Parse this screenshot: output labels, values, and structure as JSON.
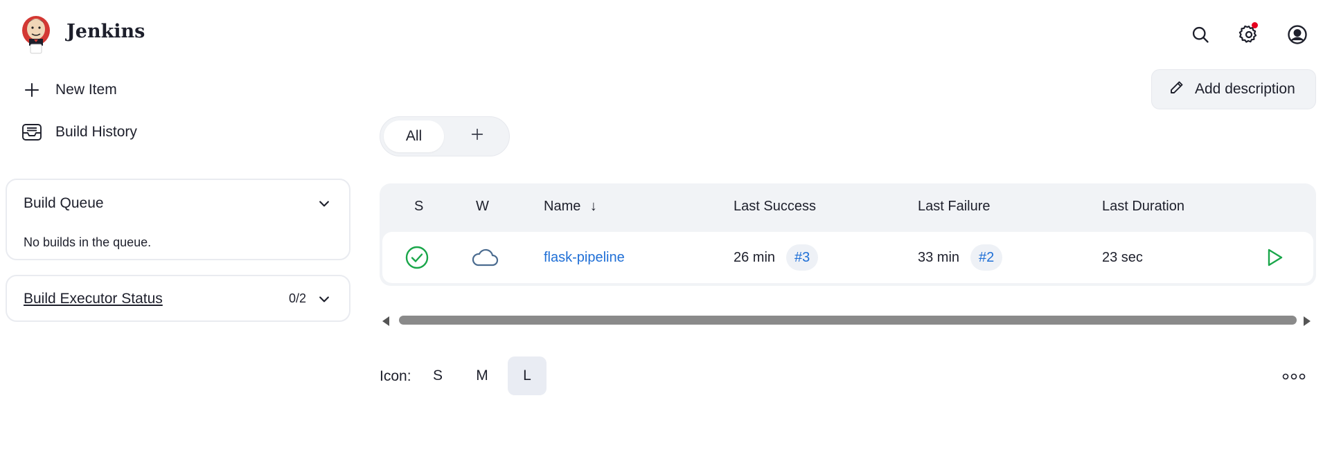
{
  "header": {
    "brand": "Jenkins",
    "icons": [
      "search-icon",
      "settings-icon",
      "user-icon"
    ],
    "notification_color": "#e6001f"
  },
  "sidebar": {
    "new_item": "New Item",
    "build_history": "Build History",
    "build_queue": {
      "title": "Build Queue",
      "empty_text": "No builds in the queue."
    },
    "executor_status": {
      "title": "Build Executor Status",
      "count": "0/2"
    }
  },
  "main": {
    "add_description": "Add description",
    "tabs": {
      "all": "All"
    },
    "table": {
      "columns": {
        "s": "S",
        "w": "W",
        "name": "Name",
        "sort_indicator": "↓",
        "last_success": "Last Success",
        "last_failure": "Last Failure",
        "last_duration": "Last Duration"
      },
      "rows": [
        {
          "status": "success",
          "weather": "cloudy",
          "name": "flask-pipeline",
          "last_success": "26 min",
          "last_success_build": "#3",
          "last_failure": "33 min",
          "last_failure_build": "#2",
          "last_duration": "23 sec"
        }
      ]
    },
    "icon_size": {
      "label": "Icon:",
      "options": [
        "S",
        "M",
        "L"
      ],
      "selected": "L"
    }
  },
  "colors": {
    "success": "#1aa64a",
    "link": "#1f6fd6",
    "weather": "#4a6b8f"
  }
}
